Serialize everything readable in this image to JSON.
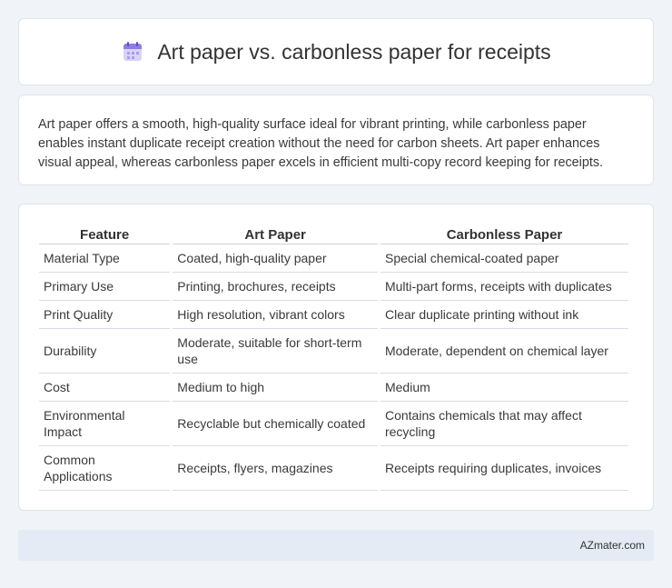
{
  "header": {
    "title": "Art paper vs. carbonless paper for receipts",
    "icon": "calendar-icon"
  },
  "intro": {
    "text": "Art paper offers a smooth, high-quality surface ideal for vibrant printing, while carbonless paper enables instant duplicate receipt creation without the need for carbon sheets. Art paper enhances visual appeal, whereas carbonless paper excels in efficient multi-copy record keeping for receipts."
  },
  "table": {
    "headers": [
      "Feature",
      "Art Paper",
      "Carbonless Paper"
    ],
    "rows": [
      [
        "Material Type",
        "Coated, high-quality paper",
        "Special chemical-coated paper"
      ],
      [
        "Primary Use",
        "Printing, brochures, receipts",
        "Multi-part forms, receipts with duplicates"
      ],
      [
        "Print Quality",
        "High resolution, vibrant colors",
        "Clear duplicate printing without ink"
      ],
      [
        "Durability",
        "Moderate, suitable for short-term use",
        "Moderate, dependent on chemical layer"
      ],
      [
        "Cost",
        "Medium to high",
        "Medium"
      ],
      [
        "Environmental Impact",
        "Recyclable but chemically coated",
        "Contains chemicals that may affect recycling"
      ],
      [
        "Common Applications",
        "Receipts, flyers, magazines",
        "Receipts requiring duplicates, invoices"
      ]
    ]
  },
  "footer": {
    "brand": "AZmater.com"
  }
}
